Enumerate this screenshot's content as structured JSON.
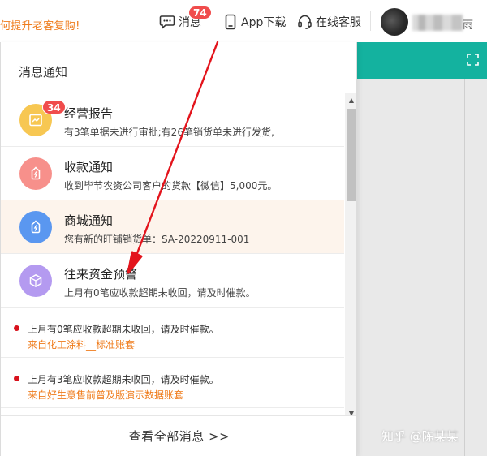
{
  "topbar": {
    "promo_text": "何提升老客复购!",
    "messages_label": "消息",
    "messages_badge": "74",
    "app_label": "App下载",
    "service_label": "在线客服",
    "user_name_tail": "雨"
  },
  "panel": {
    "title": "消息通知",
    "cards": [
      {
        "title": "经营报告",
        "desc": "有3笔单据未进行审批;有26笔销货单未进行发货,",
        "badge": "34",
        "icon": "report-icon",
        "color": "#f7c752"
      },
      {
        "title": "收款通知",
        "desc": "收到毕节农资公司客户的货款【微信】5,000元。",
        "icon": "payment-icon",
        "color": "#f7908b"
      },
      {
        "title": "商城通知",
        "desc": "您有新的旺铺销货单：SA-20220911-001",
        "icon": "mall-icon",
        "color": "#5a97f0"
      },
      {
        "title": "往来资金预警",
        "desc": "上月有0笔应收款超期未收回，请及时催款。",
        "icon": "box-icon",
        "color": "#b49af0"
      }
    ],
    "warnings": [
      {
        "text": "上月有0笔应收款超期未收回，请及时催款。",
        "source": "来自化工涂料__标准账套"
      },
      {
        "text": "上月有3笔应收款超期未收回，请及时催款。",
        "source": "来自好生意售前普及版演示数据账套"
      }
    ],
    "view_all": "查看全部消息 >>"
  },
  "watermark": "知乎 @陈某某",
  "colors": {
    "accent_orange": "#ef7c1c",
    "badge_red": "#f04c4c",
    "teal": "#14b29f",
    "arrow_red": "#e3141c"
  }
}
